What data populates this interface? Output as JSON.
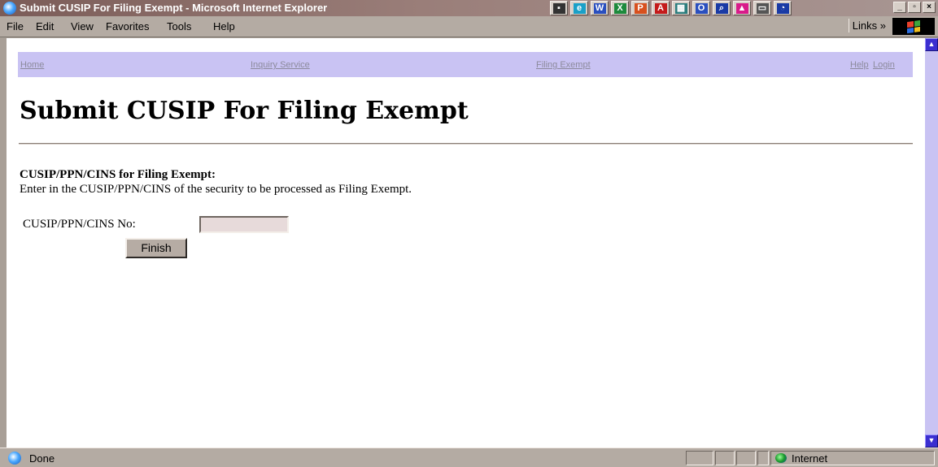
{
  "window": {
    "title": "Submit CUSIP For Filing Exempt - Microsoft Internet Explorer",
    "controls": {
      "minimize": "_",
      "maximize": "▫",
      "close": "×"
    }
  },
  "tray_icons": [
    {
      "name": "media",
      "color": "#333333",
      "glyph": "▪"
    },
    {
      "name": "ie",
      "color": "#1aa0c8",
      "glyph": "e"
    },
    {
      "name": "word",
      "color": "#2a4fbf",
      "glyph": "W"
    },
    {
      "name": "excel",
      "color": "#1d8a3c",
      "glyph": "X"
    },
    {
      "name": "powerpoint",
      "color": "#d8501e",
      "glyph": "P"
    },
    {
      "name": "acrobat",
      "color": "#c41b1b",
      "glyph": "A"
    },
    {
      "name": "project",
      "color": "#2a7d7d",
      "glyph": "▦"
    },
    {
      "name": "outlook",
      "color": "#2a4fbf",
      "glyph": "O"
    },
    {
      "name": "search",
      "color": "#1a3aa5",
      "glyph": "⌕"
    },
    {
      "name": "image",
      "color": "#d81b8a",
      "glyph": "▲"
    },
    {
      "name": "window",
      "color": "#555555",
      "glyph": "▭"
    },
    {
      "name": "find",
      "color": "#1a3aa5",
      "glyph": "◔"
    }
  ],
  "menu": {
    "items": [
      "File",
      "Edit",
      "View",
      "Favorites",
      "Tools",
      "Help"
    ],
    "links_label": "Links »"
  },
  "page": {
    "nav": {
      "home": "Home",
      "inquiry": "Inquiry Service",
      "filing": "Filing Exempt",
      "help": "Help",
      "login": "Login"
    },
    "title": "Submit CUSIP For Filing Exempt",
    "section_heading": "CUSIP/PPN/CINS for Filing Exempt:",
    "section_description": "Enter in the CUSIP/PPN/CINS of the security to be processed as Filing Exempt.",
    "form": {
      "label": "CUSIP/PPN/CINS No:",
      "value": "",
      "button": "Finish"
    }
  },
  "status": {
    "text": "Done",
    "zone": "Internet"
  },
  "colors": {
    "nav_bar": "#c9c3f3",
    "nav_link": "#8c8a9c",
    "chrome": "#b4aba3",
    "scrollbar_button": "#3b2fd0"
  }
}
